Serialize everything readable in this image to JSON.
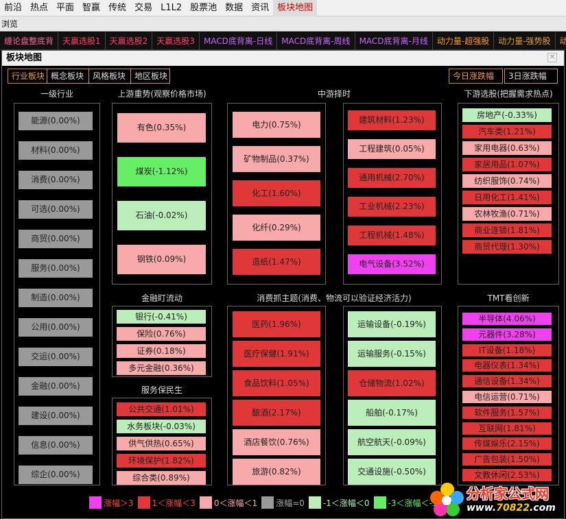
{
  "menu": [
    "前沿",
    "热点",
    "平面",
    "智赢",
    "传统",
    "交易",
    "L1L2",
    "股票池",
    "数据",
    "资讯",
    "板块地图"
  ],
  "browse_label": "浏览",
  "strategy_tabs": [
    {
      "label": "缠论盘整底背",
      "color": "#ff6699"
    },
    {
      "label": "天赢选股1",
      "color": "#ff4466"
    },
    {
      "label": "天赢选股2",
      "color": "#ff4466"
    },
    {
      "label": "天赢选股3",
      "color": "#ff4466"
    },
    {
      "label": "MACD底背离-日线",
      "color": "#cc66ff"
    },
    {
      "label": "MACD底背离-周线",
      "color": "#cc66ff"
    },
    {
      "label": "MACD底背离-月线",
      "color": "#cc66ff"
    },
    {
      "label": "动力量-超强股",
      "color": "#ff9933"
    },
    {
      "label": "动力量-强势股",
      "color": "#e0a030"
    },
    {
      "label": "动",
      "color": "#ff9933"
    }
  ],
  "window_title": "板块地图",
  "close_glyph": "✕",
  "board_tabs": [
    "行业板块",
    "概念板块",
    "风格板块",
    "地区板块"
  ],
  "period_tabs": [
    "今日涨跌幅",
    "3日涨跌幅"
  ],
  "colors": {
    "c5": "#f040f0",
    "c4": "#e03838",
    "c3": "#f8aaaa",
    "c2": "#999999",
    "c1": "#bbeebb",
    "c0": "#66ee66"
  },
  "sections": {
    "primary": {
      "title": "一级行业",
      "items": [
        {
          "label": "能源(0.00%)",
          "cat": "c2"
        },
        {
          "label": "材料(0.00%)",
          "cat": "c2"
        },
        {
          "label": "消费(0.00%)",
          "cat": "c2"
        },
        {
          "label": "可选(0.00%)",
          "cat": "c2"
        },
        {
          "label": "商贸(0.00%)",
          "cat": "c2"
        },
        {
          "label": "服务(0.00%)",
          "cat": "c2"
        },
        {
          "label": "制造(0.00%)",
          "cat": "c2"
        },
        {
          "label": "公用(0.00%)",
          "cat": "c2"
        },
        {
          "label": "交运(0.00%)",
          "cat": "c2"
        },
        {
          "label": "金融(0.00%)",
          "cat": "c2"
        },
        {
          "label": "建设(0.00%)",
          "cat": "c2"
        },
        {
          "label": "信息(0.00%)",
          "cat": "c2"
        },
        {
          "label": "综企(0.00%)",
          "cat": "c2"
        }
      ]
    },
    "upstream": {
      "title": "上游重势(观察价格市场)",
      "items": [
        {
          "label": "有色(0.35%)",
          "cat": "c3"
        },
        {
          "label": "煤炭(-1.12%)",
          "cat": "c0"
        },
        {
          "label": "石油(-0.02%)",
          "cat": "c1"
        },
        {
          "label": "钢铁(0.09%)",
          "cat": "c3"
        }
      ]
    },
    "midstream": {
      "title": "中游择时",
      "left": [
        {
          "label": "电力(0.75%)",
          "cat": "c3"
        },
        {
          "label": "矿物制品(0.37%)",
          "cat": "c3"
        },
        {
          "label": "化工(1.60%)",
          "cat": "c4"
        },
        {
          "label": "化纤(0.29%)",
          "cat": "c3"
        },
        {
          "label": "造纸(1.47%)",
          "cat": "c4"
        }
      ],
      "right": [
        {
          "label": "建筑材料(1.23%)",
          "cat": "c4"
        },
        {
          "label": "工程建筑(0.05%)",
          "cat": "c3"
        },
        {
          "label": "通用机械(2.70%)",
          "cat": "c4"
        },
        {
          "label": "工业机械(2.23%)",
          "cat": "c4"
        },
        {
          "label": "工程机械(1.48%)",
          "cat": "c4"
        },
        {
          "label": "电气设备(3.52%)",
          "cat": "c5"
        }
      ]
    },
    "downstream": {
      "title": "下游选股(把握需求热点)",
      "items": [
        {
          "label": "房地产(-0.33%)",
          "cat": "c1"
        },
        {
          "label": "汽车类(1.21%)",
          "cat": "c4"
        },
        {
          "label": "家用电器(0.63%)",
          "cat": "c3"
        },
        {
          "label": "家居用品(1.07%)",
          "cat": "c4"
        },
        {
          "label": "纺织服饰(0.74%)",
          "cat": "c3"
        },
        {
          "label": "日用化工(1.41%)",
          "cat": "c4"
        },
        {
          "label": "农林牧渔(0.71%)",
          "cat": "c3"
        },
        {
          "label": "商业连锁(1.81%)",
          "cat": "c4"
        },
        {
          "label": "商贸代理(1.30%)",
          "cat": "c4"
        }
      ]
    },
    "finance": {
      "title": "金融盯流动",
      "items": [
        {
          "label": "银行(-0.41%)",
          "cat": "c1"
        },
        {
          "label": "保险(0.76%)",
          "cat": "c3"
        },
        {
          "label": "证券(0.18%)",
          "cat": "c3"
        },
        {
          "label": "多元金融(0.36%)",
          "cat": "c3"
        }
      ]
    },
    "service": {
      "title": "服务保民生",
      "items": [
        {
          "label": "公共交通(1.01%)",
          "cat": "c4"
        },
        {
          "label": "水务板块(-0.03%)",
          "cat": "c1"
        },
        {
          "label": "供气供热(0.65%)",
          "cat": "c3"
        },
        {
          "label": "环境保护(1.82%)",
          "cat": "c4"
        },
        {
          "label": "综合类(0.89%)",
          "cat": "c3"
        }
      ]
    },
    "consumer": {
      "title": "消费抓主题(消费、物流可以验证经济活力)",
      "left": [
        {
          "label": "医药(1.96%)",
          "cat": "c4"
        },
        {
          "label": "医疗保健(1.91%)",
          "cat": "c4"
        },
        {
          "label": "食品饮料(1.05%)",
          "cat": "c4"
        },
        {
          "label": "酿酒(2.17%)",
          "cat": "c4"
        },
        {
          "label": "酒店餐饮(0.76%)",
          "cat": "c3"
        },
        {
          "label": "旅游(0.82%)",
          "cat": "c3"
        }
      ],
      "right": [
        {
          "label": "运输设备(-0.19%)",
          "cat": "c1"
        },
        {
          "label": "运输服务(-0.15%)",
          "cat": "c1"
        },
        {
          "label": "仓储物流(1.02%)",
          "cat": "c4"
        },
        {
          "label": "船舶(-0.17%)",
          "cat": "c1"
        },
        {
          "label": "航空航天(-0.09%)",
          "cat": "c1"
        },
        {
          "label": "交通设施(-0.50%)",
          "cat": "c1"
        }
      ]
    },
    "tmt": {
      "title": "TMT看创新",
      "items": [
        {
          "label": "半导体(4.06%)",
          "cat": "c5"
        },
        {
          "label": "元器件(3.28%)",
          "cat": "c5"
        },
        {
          "label": "IT设备(1.18%)",
          "cat": "c4"
        },
        {
          "label": "电器仪表(1.34%)",
          "cat": "c4"
        },
        {
          "label": "通信设备(1.34%)",
          "cat": "c4"
        },
        {
          "label": "电信运营(0.71%)",
          "cat": "c3"
        },
        {
          "label": "软件服务(1.57%)",
          "cat": "c4"
        },
        {
          "label": "互联网(1.81%)",
          "cat": "c4"
        },
        {
          "label": "传媒娱乐(2.15%)",
          "cat": "c4"
        },
        {
          "label": "广告包装(1.50%)",
          "cat": "c4"
        },
        {
          "label": "文教休闲(2.53%)",
          "cat": "c4"
        }
      ]
    }
  },
  "legend": [
    {
      "label": "涨幅＞3",
      "cat": "c5",
      "text_color": "#ff4444"
    },
    {
      "label": "1＜涨幅＜3",
      "cat": "c4",
      "text_color": "#ff4444"
    },
    {
      "label": "0＜涨幅＜1",
      "cat": "c3",
      "text_color": "#ffaaaa"
    },
    {
      "label": "涨幅=0",
      "cat": "c2",
      "text_color": "#aaaaaa"
    },
    {
      "label": "-1＜涨幅＜0",
      "cat": "c1",
      "text_color": "#bbeebb"
    },
    {
      "label": "-3＜涨幅＜-1",
      "cat": "c0",
      "text_color": "#66ee66"
    }
  ],
  "watermark": {
    "title": "分析家公式网",
    "url_prefix": "www.",
    "url_main": "70822",
    "url_suffix": ".com"
  }
}
